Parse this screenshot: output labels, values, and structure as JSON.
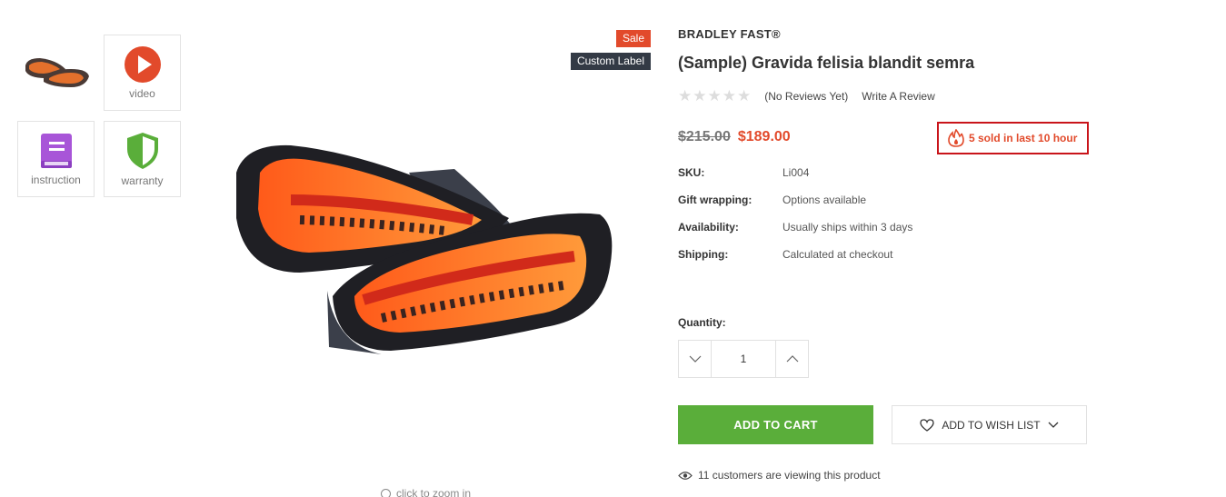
{
  "thumbnails": {
    "video_label": "video",
    "instruction_label": "instruction",
    "warranty_label": "warranty"
  },
  "badges": {
    "sale": "Sale",
    "custom": "Custom Label"
  },
  "image": {
    "zoom_hint": "click to zoom in"
  },
  "product": {
    "brand": "BRADLEY FAST®",
    "title": "(Sample) Gravida felisia blandit semra",
    "reviews_text": "(No Reviews Yet)",
    "write_review": "Write A Review",
    "rating": 0,
    "old_price": "$215.00",
    "price": "$189.00",
    "sold_text": "5 sold in last 10 hour",
    "specs": [
      {
        "label": "SKU:",
        "value": "Li004"
      },
      {
        "label": "Gift wrapping:",
        "value": "Options available"
      },
      {
        "label": "Availability:",
        "value": "Usually ships within 3 days"
      },
      {
        "label": "Shipping:",
        "value": "Calculated at checkout"
      }
    ]
  },
  "quantity": {
    "label": "Quantity:",
    "value": "1"
  },
  "actions": {
    "add_to_cart": "ADD TO CART",
    "add_to_wishlist": "ADD TO WISH LIST"
  },
  "viewing_text": "11 customers are viewing this product",
  "colors": {
    "accent_red": "#e24a2b",
    "add_to_cart_green": "#5aae3a",
    "sold_border": "#c9141a",
    "custom_label_bg": "#333a45",
    "instruction_icon": "#a855d8",
    "warranty_icon": "#5aae3a"
  }
}
